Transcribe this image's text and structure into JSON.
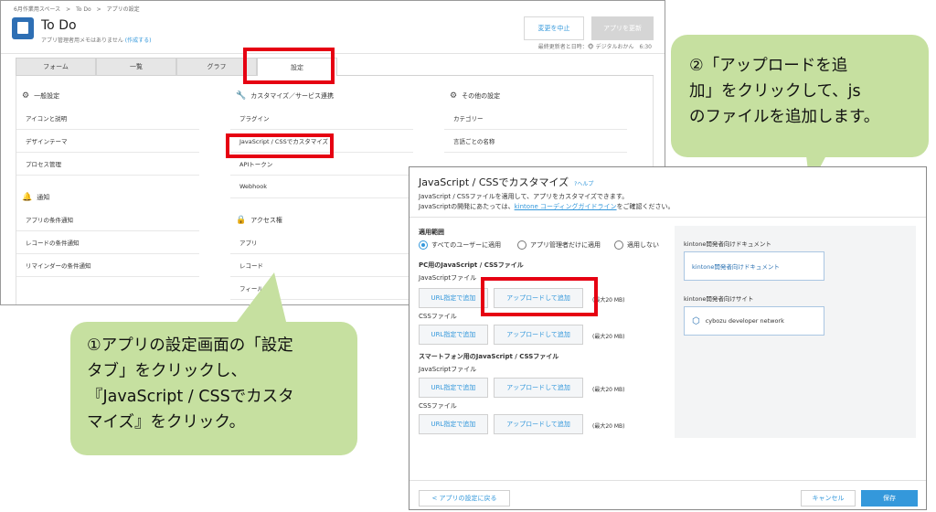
{
  "app_window": {
    "breadcrumb": "6月作業用スペース　>　To Do　>　アプリの設定",
    "title": "To Do",
    "memo": "アプリ管理者用メモはありません",
    "memo_link": "(作成する)",
    "cancel_change": "変更を中止",
    "update_app": "アプリを更新",
    "last_updater": "最終更新者と日時：🐵 デジタルおかん　6:30",
    "tabs": [
      {
        "label": "フォーム"
      },
      {
        "label": "一覧"
      },
      {
        "label": "グラフ"
      },
      {
        "label": "設定"
      }
    ],
    "col1": {
      "general_title": "一般設定",
      "general_items": [
        "アイコンと説明",
        "デザインテーマ",
        "プロセス管理"
      ],
      "notify_title": "通知",
      "notify_items": [
        "アプリの条件通知",
        "レコードの条件通知",
        "リマインダーの条件通知"
      ]
    },
    "col2": {
      "custom_title": "カスタマイズ／サービス連携",
      "custom_items": [
        "プラグイン",
        "JavaScript / CSSでカスタマイズ",
        "APIトークン",
        "Webhook"
      ],
      "access_title": "アクセス権",
      "access_items": [
        "アプリ",
        "レコード",
        "フィールド"
      ]
    },
    "col3": {
      "other_title": "その他の設定",
      "other_items": [
        "カテゴリー",
        "言語ごとの名称"
      ]
    }
  },
  "dialog": {
    "title": "JavaScript / CSSでカスタマイズ",
    "help": "?ヘルプ",
    "desc1": "JavaScript / CSSファイルを適用して、アプリをカスタマイズできます。",
    "desc2_pre": "JavaScriptの開発にあたっては、",
    "desc2_link": "kintone コーディングガイドライン",
    "desc2_post": "をご確認ください。",
    "scope_label": "適用範囲",
    "scope_options": [
      "すべてのユーザーに適用",
      "アプリ管理者だけに適用",
      "適用しない"
    ],
    "pc_title": "PC用のJavaScript / CSSファイル",
    "sp_title": "スマートフォン用のJavaScript / CSSファイル",
    "js_label": "JavaScriptファイル",
    "css_label": "CSSファイル",
    "url_btn": "URL指定で追加",
    "upload_btn": "アップロードして追加",
    "max_size": "(最大20 MB)",
    "side_doc_label": "kintone開発者向けドキュメント",
    "side_doc_card": "kintone開発者向けドキュメント",
    "side_site_label": "kintone開発者向けサイト",
    "side_site_card": "cybozu developer network",
    "back": "< アプリの設定に戻る",
    "cancel": "キャンセル",
    "save": "保存"
  },
  "callouts": {
    "step1": "①アプリの設定画面の「設定\nタブ」をクリックし、\n『JavaScript / CSSでカスタ\nマイズ』をクリック。",
    "step2": "②「アップロードを追\n加」をクリックして、js\nのファイルを追加します。"
  },
  "colors": {
    "highlight": "#e60012",
    "callout": "#c6e0a0",
    "accent": "#3498db"
  }
}
